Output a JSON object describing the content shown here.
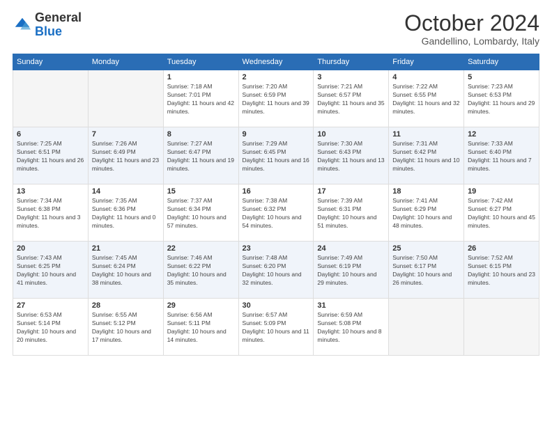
{
  "header": {
    "logo_general": "General",
    "logo_blue": "Blue",
    "month": "October 2024",
    "location": "Gandellino, Lombardy, Italy"
  },
  "days_of_week": [
    "Sunday",
    "Monday",
    "Tuesday",
    "Wednesday",
    "Thursday",
    "Friday",
    "Saturday"
  ],
  "weeks": [
    [
      {
        "day": "",
        "sunrise": "",
        "sunset": "",
        "daylight": ""
      },
      {
        "day": "",
        "sunrise": "",
        "sunset": "",
        "daylight": ""
      },
      {
        "day": "1",
        "sunrise": "Sunrise: 7:18 AM",
        "sunset": "Sunset: 7:01 PM",
        "daylight": "Daylight: 11 hours and 42 minutes."
      },
      {
        "day": "2",
        "sunrise": "Sunrise: 7:20 AM",
        "sunset": "Sunset: 6:59 PM",
        "daylight": "Daylight: 11 hours and 39 minutes."
      },
      {
        "day": "3",
        "sunrise": "Sunrise: 7:21 AM",
        "sunset": "Sunset: 6:57 PM",
        "daylight": "Daylight: 11 hours and 35 minutes."
      },
      {
        "day": "4",
        "sunrise": "Sunrise: 7:22 AM",
        "sunset": "Sunset: 6:55 PM",
        "daylight": "Daylight: 11 hours and 32 minutes."
      },
      {
        "day": "5",
        "sunrise": "Sunrise: 7:23 AM",
        "sunset": "Sunset: 6:53 PM",
        "daylight": "Daylight: 11 hours and 29 minutes."
      }
    ],
    [
      {
        "day": "6",
        "sunrise": "Sunrise: 7:25 AM",
        "sunset": "Sunset: 6:51 PM",
        "daylight": "Daylight: 11 hours and 26 minutes."
      },
      {
        "day": "7",
        "sunrise": "Sunrise: 7:26 AM",
        "sunset": "Sunset: 6:49 PM",
        "daylight": "Daylight: 11 hours and 23 minutes."
      },
      {
        "day": "8",
        "sunrise": "Sunrise: 7:27 AM",
        "sunset": "Sunset: 6:47 PM",
        "daylight": "Daylight: 11 hours and 19 minutes."
      },
      {
        "day": "9",
        "sunrise": "Sunrise: 7:29 AM",
        "sunset": "Sunset: 6:45 PM",
        "daylight": "Daylight: 11 hours and 16 minutes."
      },
      {
        "day": "10",
        "sunrise": "Sunrise: 7:30 AM",
        "sunset": "Sunset: 6:43 PM",
        "daylight": "Daylight: 11 hours and 13 minutes."
      },
      {
        "day": "11",
        "sunrise": "Sunrise: 7:31 AM",
        "sunset": "Sunset: 6:42 PM",
        "daylight": "Daylight: 11 hours and 10 minutes."
      },
      {
        "day": "12",
        "sunrise": "Sunrise: 7:33 AM",
        "sunset": "Sunset: 6:40 PM",
        "daylight": "Daylight: 11 hours and 7 minutes."
      }
    ],
    [
      {
        "day": "13",
        "sunrise": "Sunrise: 7:34 AM",
        "sunset": "Sunset: 6:38 PM",
        "daylight": "Daylight: 11 hours and 3 minutes."
      },
      {
        "day": "14",
        "sunrise": "Sunrise: 7:35 AM",
        "sunset": "Sunset: 6:36 PM",
        "daylight": "Daylight: 11 hours and 0 minutes."
      },
      {
        "day": "15",
        "sunrise": "Sunrise: 7:37 AM",
        "sunset": "Sunset: 6:34 PM",
        "daylight": "Daylight: 10 hours and 57 minutes."
      },
      {
        "day": "16",
        "sunrise": "Sunrise: 7:38 AM",
        "sunset": "Sunset: 6:32 PM",
        "daylight": "Daylight: 10 hours and 54 minutes."
      },
      {
        "day": "17",
        "sunrise": "Sunrise: 7:39 AM",
        "sunset": "Sunset: 6:31 PM",
        "daylight": "Daylight: 10 hours and 51 minutes."
      },
      {
        "day": "18",
        "sunrise": "Sunrise: 7:41 AM",
        "sunset": "Sunset: 6:29 PM",
        "daylight": "Daylight: 10 hours and 48 minutes."
      },
      {
        "day": "19",
        "sunrise": "Sunrise: 7:42 AM",
        "sunset": "Sunset: 6:27 PM",
        "daylight": "Daylight: 10 hours and 45 minutes."
      }
    ],
    [
      {
        "day": "20",
        "sunrise": "Sunrise: 7:43 AM",
        "sunset": "Sunset: 6:25 PM",
        "daylight": "Daylight: 10 hours and 41 minutes."
      },
      {
        "day": "21",
        "sunrise": "Sunrise: 7:45 AM",
        "sunset": "Sunset: 6:24 PM",
        "daylight": "Daylight: 10 hours and 38 minutes."
      },
      {
        "day": "22",
        "sunrise": "Sunrise: 7:46 AM",
        "sunset": "Sunset: 6:22 PM",
        "daylight": "Daylight: 10 hours and 35 minutes."
      },
      {
        "day": "23",
        "sunrise": "Sunrise: 7:48 AM",
        "sunset": "Sunset: 6:20 PM",
        "daylight": "Daylight: 10 hours and 32 minutes."
      },
      {
        "day": "24",
        "sunrise": "Sunrise: 7:49 AM",
        "sunset": "Sunset: 6:19 PM",
        "daylight": "Daylight: 10 hours and 29 minutes."
      },
      {
        "day": "25",
        "sunrise": "Sunrise: 7:50 AM",
        "sunset": "Sunset: 6:17 PM",
        "daylight": "Daylight: 10 hours and 26 minutes."
      },
      {
        "day": "26",
        "sunrise": "Sunrise: 7:52 AM",
        "sunset": "Sunset: 6:15 PM",
        "daylight": "Daylight: 10 hours and 23 minutes."
      }
    ],
    [
      {
        "day": "27",
        "sunrise": "Sunrise: 6:53 AM",
        "sunset": "Sunset: 5:14 PM",
        "daylight": "Daylight: 10 hours and 20 minutes."
      },
      {
        "day": "28",
        "sunrise": "Sunrise: 6:55 AM",
        "sunset": "Sunset: 5:12 PM",
        "daylight": "Daylight: 10 hours and 17 minutes."
      },
      {
        "day": "29",
        "sunrise": "Sunrise: 6:56 AM",
        "sunset": "Sunset: 5:11 PM",
        "daylight": "Daylight: 10 hours and 14 minutes."
      },
      {
        "day": "30",
        "sunrise": "Sunrise: 6:57 AM",
        "sunset": "Sunset: 5:09 PM",
        "daylight": "Daylight: 10 hours and 11 minutes."
      },
      {
        "day": "31",
        "sunrise": "Sunrise: 6:59 AM",
        "sunset": "Sunset: 5:08 PM",
        "daylight": "Daylight: 10 hours and 8 minutes."
      },
      {
        "day": "",
        "sunrise": "",
        "sunset": "",
        "daylight": ""
      },
      {
        "day": "",
        "sunrise": "",
        "sunset": "",
        "daylight": ""
      }
    ]
  ]
}
